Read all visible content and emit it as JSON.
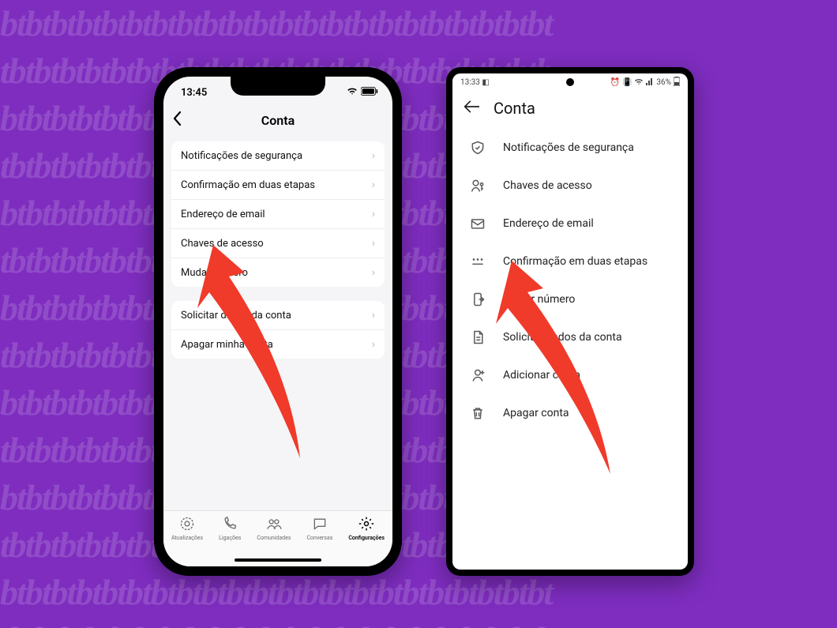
{
  "ios": {
    "status_time": "13:45",
    "nav_title": "Conta",
    "group1": [
      "Notificações de segurança",
      "Confirmação em duas etapas",
      "Endereço de email",
      "Chaves de acesso",
      "Mudar número"
    ],
    "group2": [
      "Solicitar dados da conta",
      "Apagar minha conta"
    ],
    "tabs": {
      "updates": "Atualizações",
      "calls": "Ligações",
      "communities": "Comunidades",
      "chats": "Conversas",
      "settings": "Configurações"
    }
  },
  "android": {
    "status_time": "13:33",
    "status_battery": "36%",
    "nav_title": "Conta",
    "items": {
      "security": "Notificações de segurança",
      "passkeys": "Chaves de acesso",
      "email": "Endereço de email",
      "twostep": "Confirmação em duas etapas",
      "change_number": "Mudar número",
      "request_info": "Solicitar dados da conta",
      "add_account": "Adicionar conta",
      "delete_account": "Apagar conta"
    }
  }
}
